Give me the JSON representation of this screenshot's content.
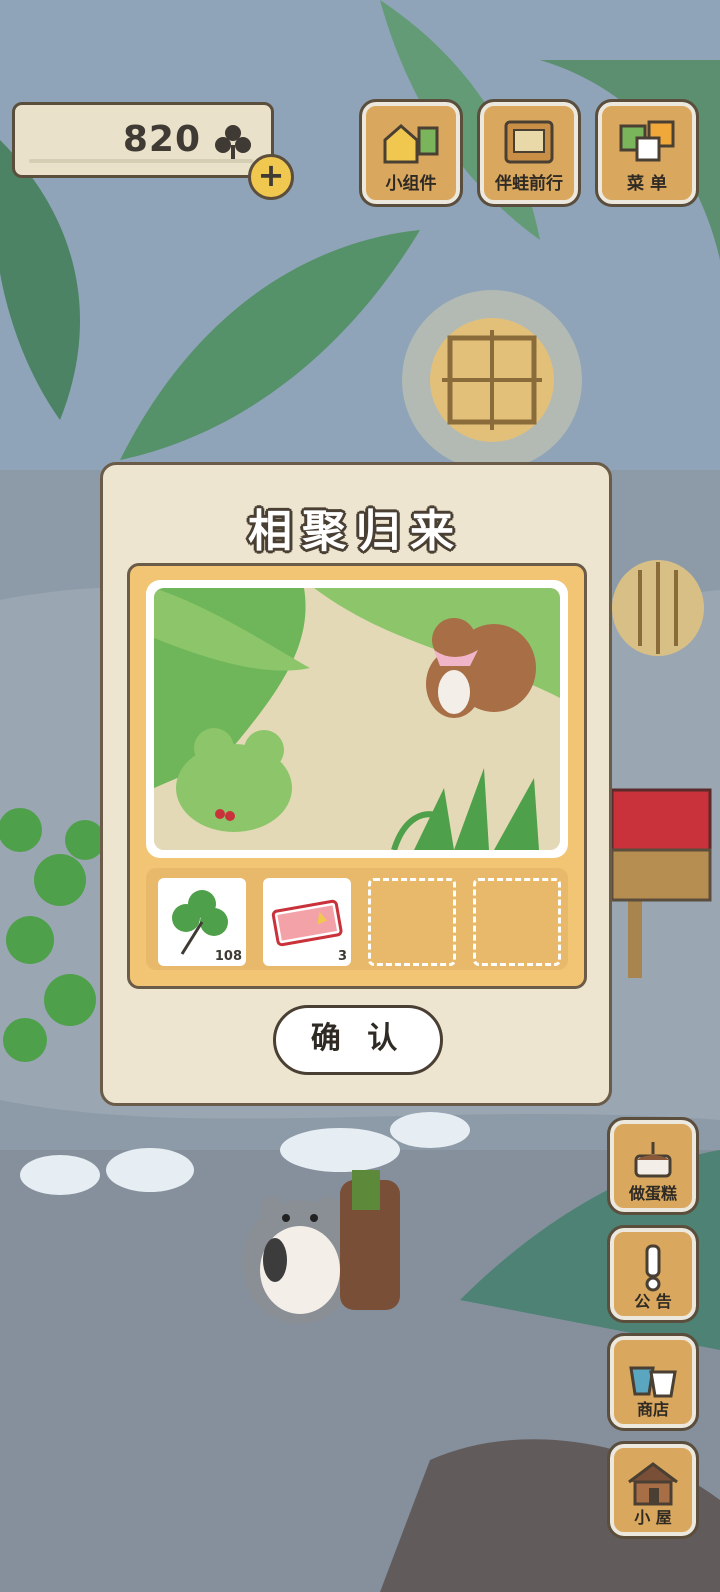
{
  "hud": {
    "clover_count": "820",
    "icons": {
      "clover": "clover-icon",
      "add": "plus-icon"
    }
  },
  "top_menu": [
    {
      "label": "小组件",
      "icon": "widget-icon"
    },
    {
      "label": "伴蛙前行",
      "icon": "book-icon"
    },
    {
      "label": "菜 单",
      "icon": "menu-cards-icon"
    }
  ],
  "side_menu": [
    {
      "label": "做蛋糕",
      "icon": "cake-icon"
    },
    {
      "label": "公 告",
      "icon": "exclamation-icon"
    },
    {
      "label": "商店",
      "icon": "bags-icon"
    },
    {
      "label": "小 屋",
      "icon": "house-icon"
    }
  ],
  "dialog": {
    "title": "相聚归来",
    "items": [
      {
        "icon": "four-leaf-clover-icon",
        "qty": "108"
      },
      {
        "icon": "ticket-icon",
        "qty": "3"
      },
      {
        "icon": "",
        "qty": ""
      },
      {
        "icon": "",
        "qty": ""
      }
    ],
    "confirm_label": "确 认"
  },
  "colors": {
    "panel": "#ede5cf",
    "frame": "#f1c574",
    "button_wood": "#d9a85e",
    "outline": "#5b4e3c",
    "gold": "#f1c84f"
  }
}
